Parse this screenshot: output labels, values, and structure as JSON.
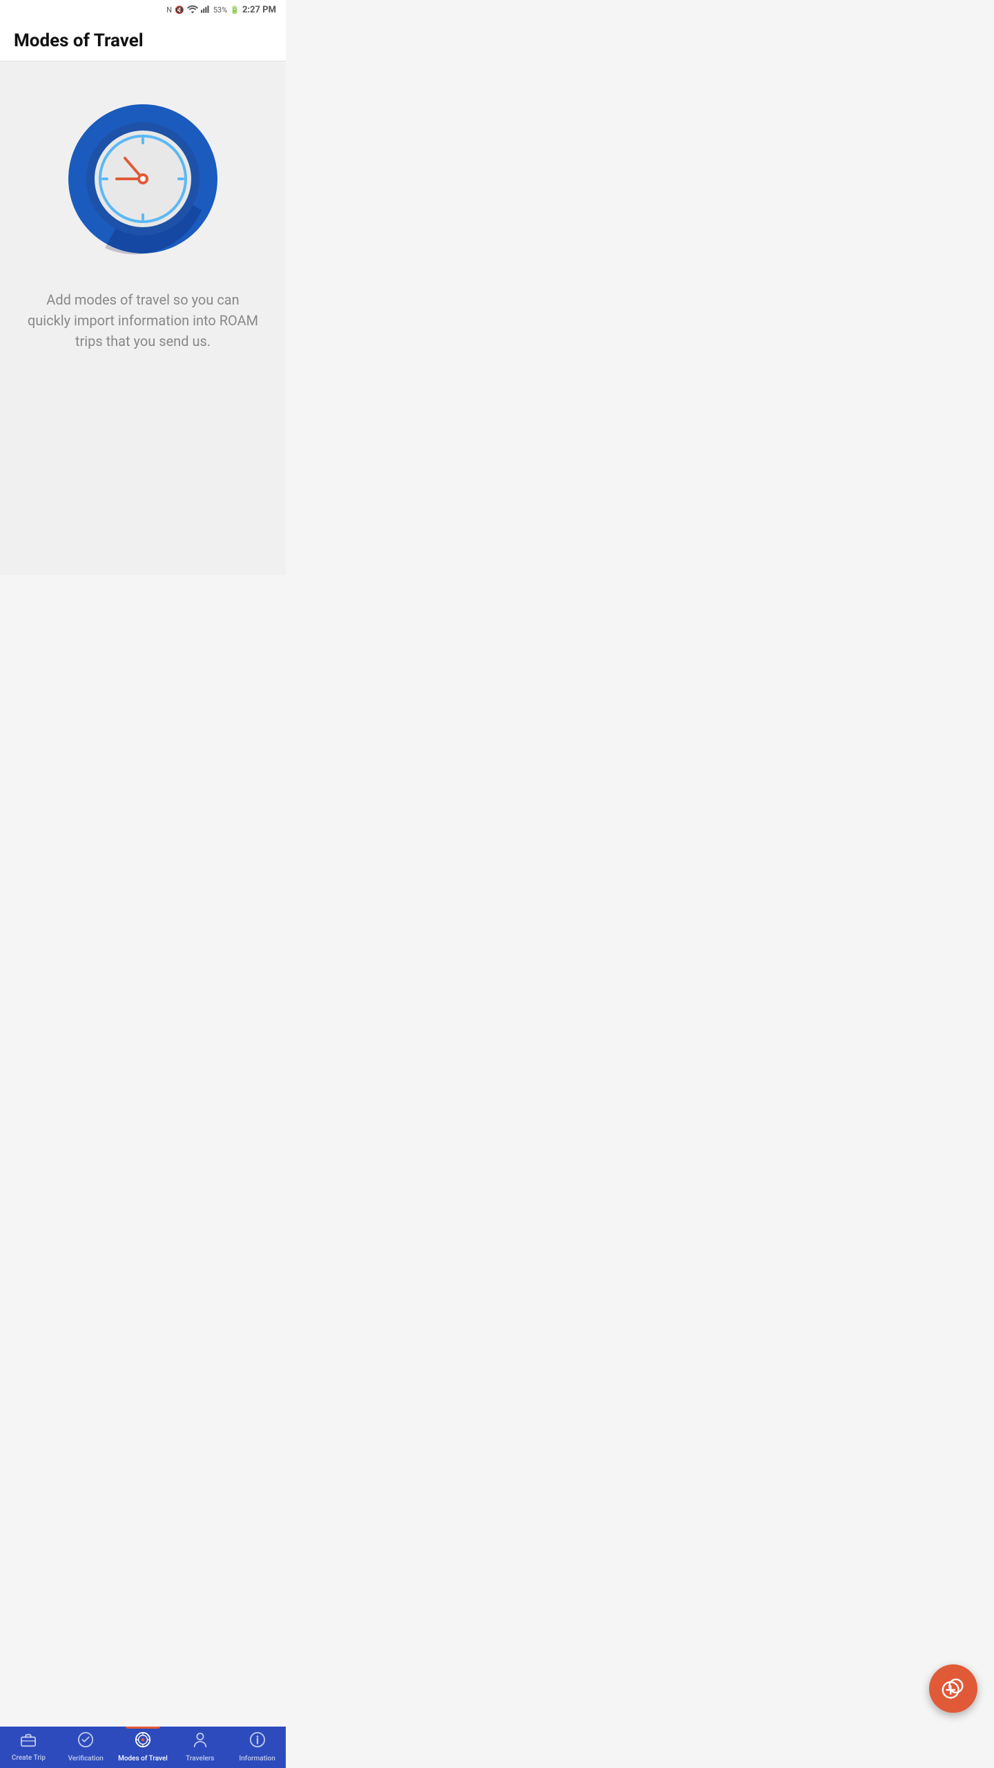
{
  "statusBar": {
    "battery": "53%",
    "time": "2:27 PM"
  },
  "header": {
    "title": "Modes of Travel"
  },
  "mainContent": {
    "description": "Add modes of travel so you can quickly import information into ROAM trips that you send us."
  },
  "bottomNav": {
    "items": [
      {
        "id": "create-trip",
        "label": "Create Trip",
        "icon": "briefcase",
        "active": false
      },
      {
        "id": "verification",
        "label": "Verification",
        "icon": "check-circle",
        "active": false
      },
      {
        "id": "modes-of-travel",
        "label": "Modes of Travel",
        "icon": "compass",
        "active": true
      },
      {
        "id": "travelers",
        "label": "Travelers",
        "icon": "person",
        "active": false
      },
      {
        "id": "information",
        "label": "Information",
        "icon": "info-circle",
        "active": false
      }
    ]
  },
  "fab": {
    "label": "Add mode of travel"
  }
}
